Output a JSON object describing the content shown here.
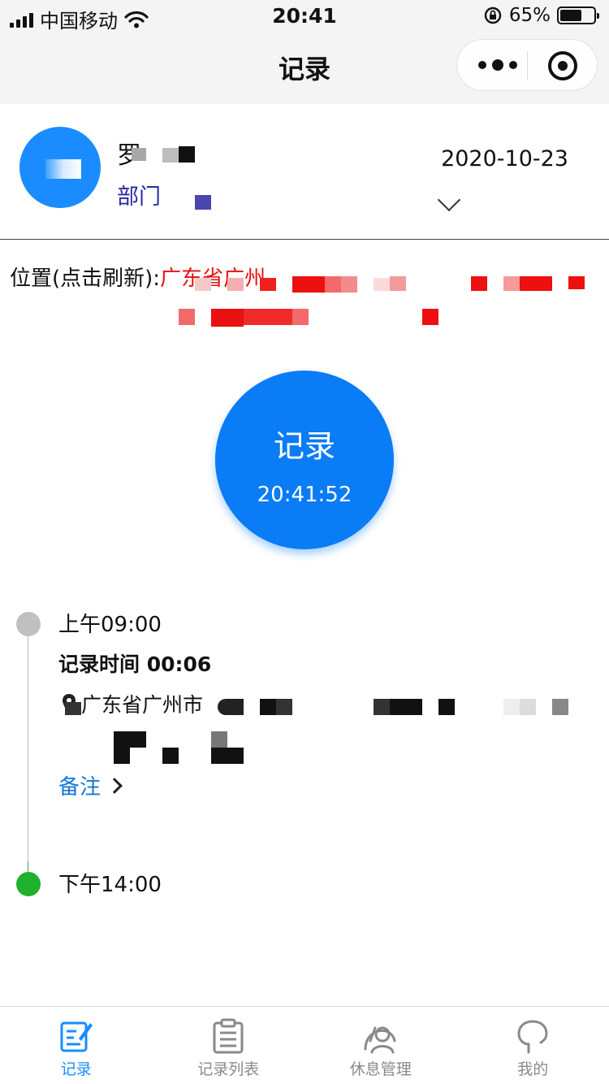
{
  "status_bar": {
    "carrier": "中国移动",
    "time": "20:41",
    "battery": "65%",
    "battery_level": 0.65
  },
  "nav": {
    "title": "记录"
  },
  "profile": {
    "name": "罗",
    "department": "部门",
    "date": "2020-10-23"
  },
  "location": {
    "label": "位置(点击刷新):",
    "value": "广东省广州"
  },
  "record_button": {
    "label": "记录",
    "clock": "20:41:52"
  },
  "timeline": [
    {
      "time": "上午09:00",
      "record_time": "记录时间 00:06",
      "location": "广东省广州市",
      "note_label": "备注"
    },
    {
      "time": "下午14:00"
    }
  ],
  "tabs": [
    {
      "label": "记录",
      "icon": "record-edit-icon",
      "active": true
    },
    {
      "label": "记录列表",
      "icon": "clipboard-list-icon",
      "active": false
    },
    {
      "label": "休息管理",
      "icon": "rest-people-icon",
      "active": false
    },
    {
      "label": "我的",
      "icon": "profile-icon",
      "active": false
    }
  ],
  "colors": {
    "accent": "#1a8cff",
    "record_button": "#0a7cf5",
    "location_text": "#e81010",
    "note_link": "#1577d6",
    "timeline_active": "#1fb02e",
    "timeline_inactive": "#c0c0c0"
  }
}
